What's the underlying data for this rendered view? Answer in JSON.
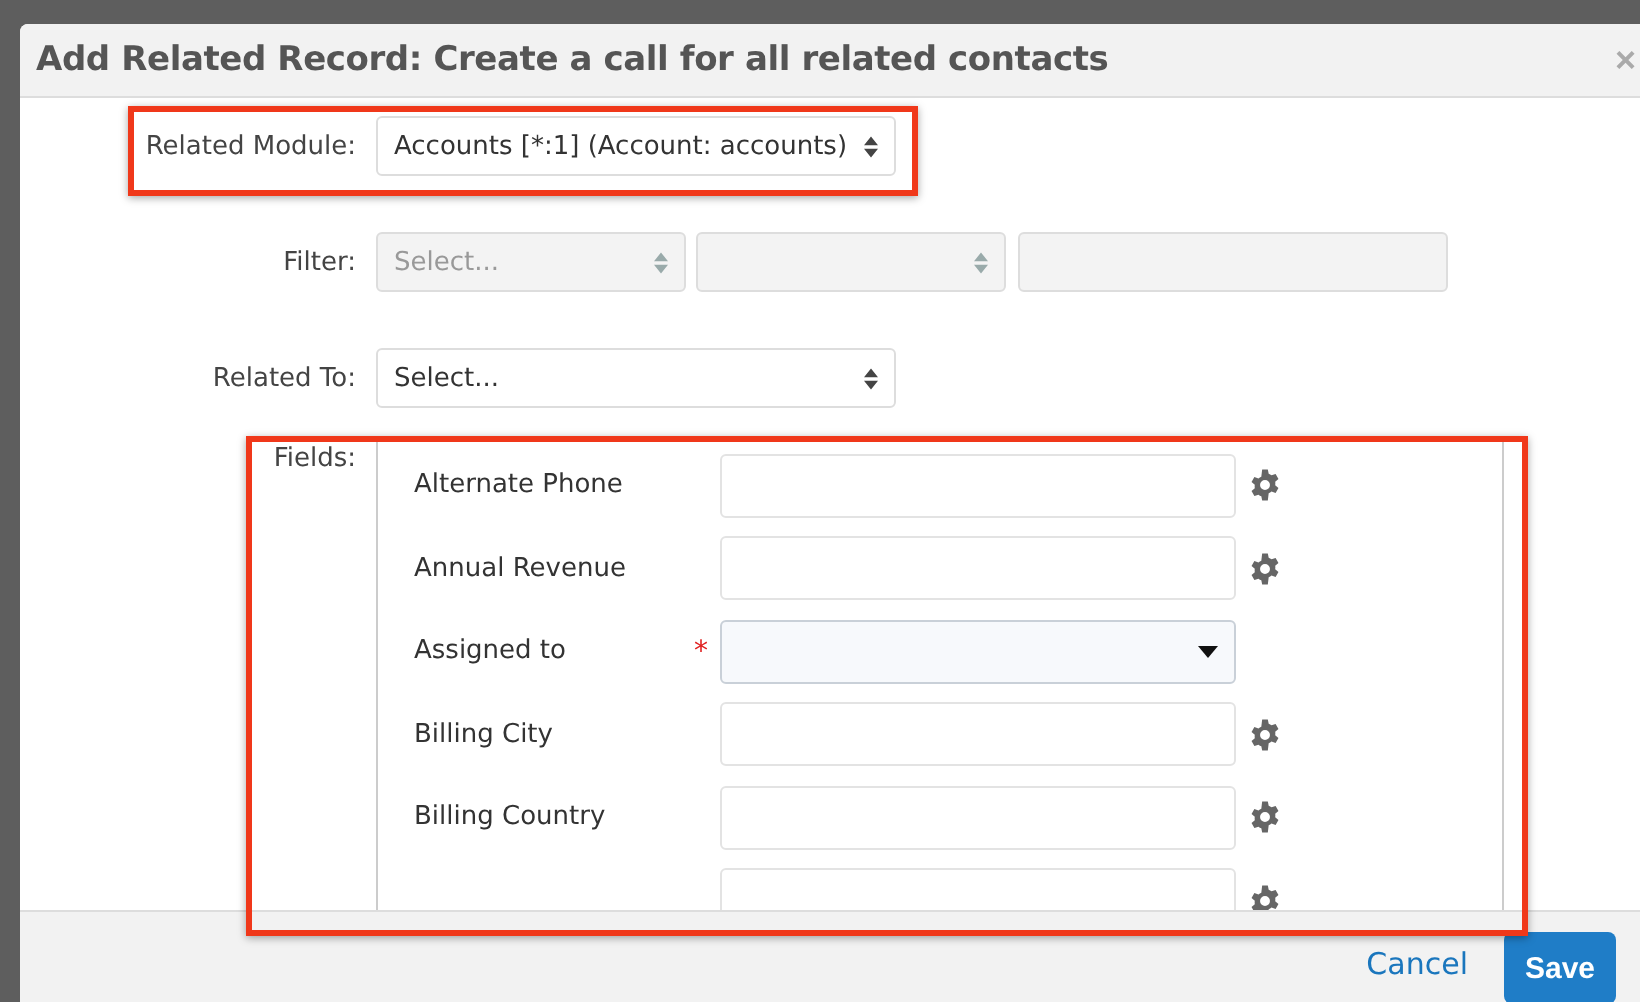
{
  "dialog": {
    "title": "Add Related Record: Create a call for all related contacts",
    "close": "×"
  },
  "related_module": {
    "label": "Related Module:",
    "value": "Accounts [*:1] (Account: accounts)"
  },
  "filter": {
    "label": "Filter:",
    "controls": [
      {
        "kind": "select",
        "placeholder": "Select...",
        "disabled": true
      },
      {
        "kind": "select",
        "disabled": true
      },
      {
        "kind": "input",
        "disabled": true
      }
    ]
  },
  "related_to": {
    "label": "Related To:",
    "value": "Select..."
  },
  "fields": {
    "label": "Fields:",
    "required_mark": "*",
    "rows": [
      {
        "label": "Alternate Phone",
        "kind": "text",
        "required": false
      },
      {
        "label": "Annual Revenue",
        "kind": "text",
        "required": false
      },
      {
        "label": "Assigned to",
        "kind": "dropdown",
        "required": true
      },
      {
        "label": "Billing City",
        "kind": "text",
        "required": false
      },
      {
        "label": "Billing Country",
        "kind": "text",
        "required": false
      },
      {
        "kind": "text",
        "required": false
      }
    ]
  },
  "annotations": [
    {
      "kind": "highlight"
    },
    {
      "kind": "highlight"
    }
  ],
  "footer": {
    "cancel": "Cancel",
    "save": "Save"
  }
}
